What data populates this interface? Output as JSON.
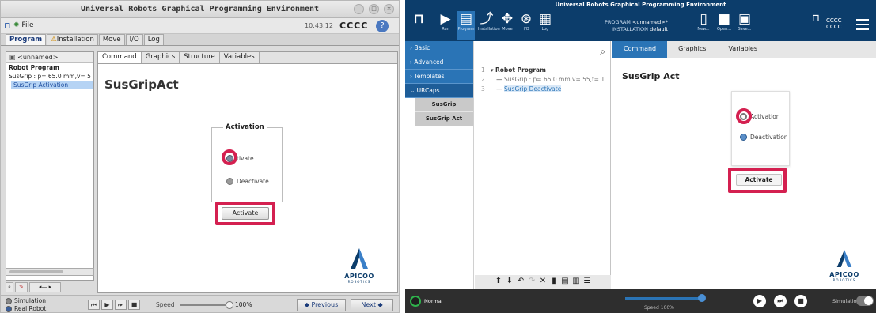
{
  "left": {
    "window_title": "Universal Robots Graphical Programming Environment",
    "menu_file": "File",
    "clock": "10:43:12",
    "serial": "CCCC",
    "tabs": [
      "Program",
      "Installation",
      "Move",
      "I/O",
      "Log"
    ],
    "program_name": "<unnamed>",
    "tree": {
      "root": "Robot Program",
      "line1": "SusGrip : p= 65.0 mm,v= 5",
      "line2": "SusGrip Activation"
    },
    "subtabs": [
      "Command",
      "Graphics",
      "Structure",
      "Variables"
    ],
    "heading": "SusGripAct",
    "group_title": "Activation",
    "radio_activate": "tivate",
    "radio_deactivate": "Deactivate",
    "activate_button": "Activate",
    "mode_simulation": "Simulation",
    "mode_real": "Real Robot",
    "speed_label": "Speed",
    "speed_value": "100%",
    "previous": "Previous",
    "next": "Next"
  },
  "right": {
    "window_title": "Universal Robots Graphical Programming Environment",
    "header_icons": [
      {
        "name": "run",
        "label": "Run",
        "glyph": "▶"
      },
      {
        "name": "program",
        "label": "Program",
        "glyph": "▤"
      },
      {
        "name": "installation",
        "label": "Installation",
        "glyph": "⤴"
      },
      {
        "name": "move",
        "label": "Move",
        "glyph": "✥"
      },
      {
        "name": "io",
        "label": "I/O",
        "glyph": "⊛"
      },
      {
        "name": "log",
        "label": "Log",
        "glyph": "▦"
      }
    ],
    "program_label": "PROGRAM",
    "program_value": "<unnamed>*",
    "installation_label": "INSTALLATION",
    "installation_value": "default",
    "file_icons": [
      {
        "name": "new",
        "label": "New..."
      },
      {
        "name": "open",
        "label": "Open..."
      },
      {
        "name": "save",
        "label": "Save..."
      }
    ],
    "serial": "CCCC",
    "side_menu": {
      "basic": "Basic",
      "advanced": "Advanced",
      "templates": "Templates",
      "urcaps": "URCaps",
      "sub1": "SusGrip",
      "sub2": "SusGrip Act"
    },
    "tree": [
      {
        "num": "1",
        "text": "Robot Program"
      },
      {
        "num": "2",
        "text": "SusGrip : p= 65.0 mm,v= 55,f= 1"
      },
      {
        "num": "3",
        "text": "SusGrip Deactivate"
      }
    ],
    "tabs": [
      "Command",
      "Graphics",
      "Variables"
    ],
    "heading": "SusGrip Act",
    "radio_activation": "Activation",
    "radio_deactivation": "Deactivation",
    "activate_button": "Activate",
    "status": "Normal",
    "speed": "Speed 100%",
    "simulation": "Simulation"
  },
  "logo": {
    "word": "APICOO",
    "tag": "ROBOTICS"
  },
  "colors": {
    "highlight": "#d42050",
    "ur_blue": "#2a74b6",
    "header": "#0c3d6b"
  }
}
